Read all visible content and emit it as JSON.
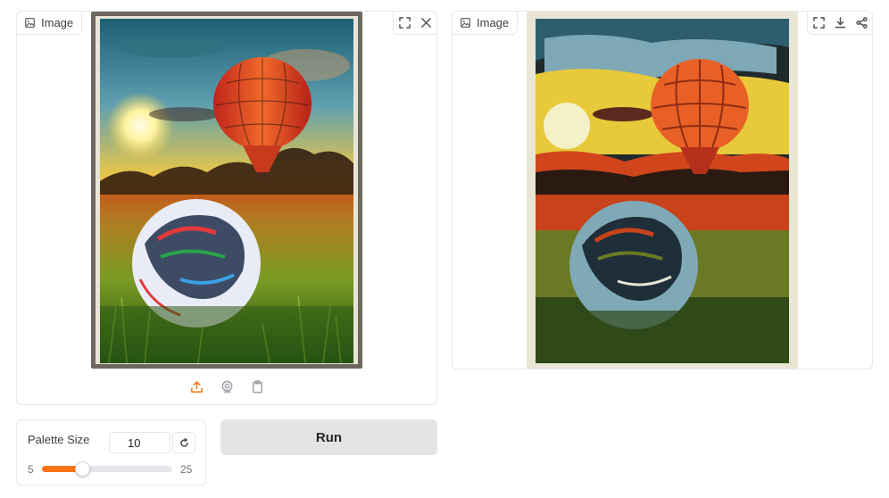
{
  "input_panel": {
    "label": "Image",
    "label_icon": "image-icon",
    "actions": [
      "fullscreen-icon",
      "close-icon"
    ],
    "source_actions": [
      "upload-icon",
      "webcam-icon",
      "clipboard-icon"
    ],
    "accent": "#f97316"
  },
  "output_panel": {
    "label": "Image",
    "label_icon": "image-icon",
    "actions": [
      "fullscreen-icon",
      "download-icon",
      "share-icon"
    ]
  },
  "slider": {
    "label": "Palette Size",
    "value": "10",
    "min": "5",
    "max": "25",
    "fraction": 0.25,
    "reset_icon": "reset-icon"
  },
  "run_button": {
    "label": "Run"
  }
}
